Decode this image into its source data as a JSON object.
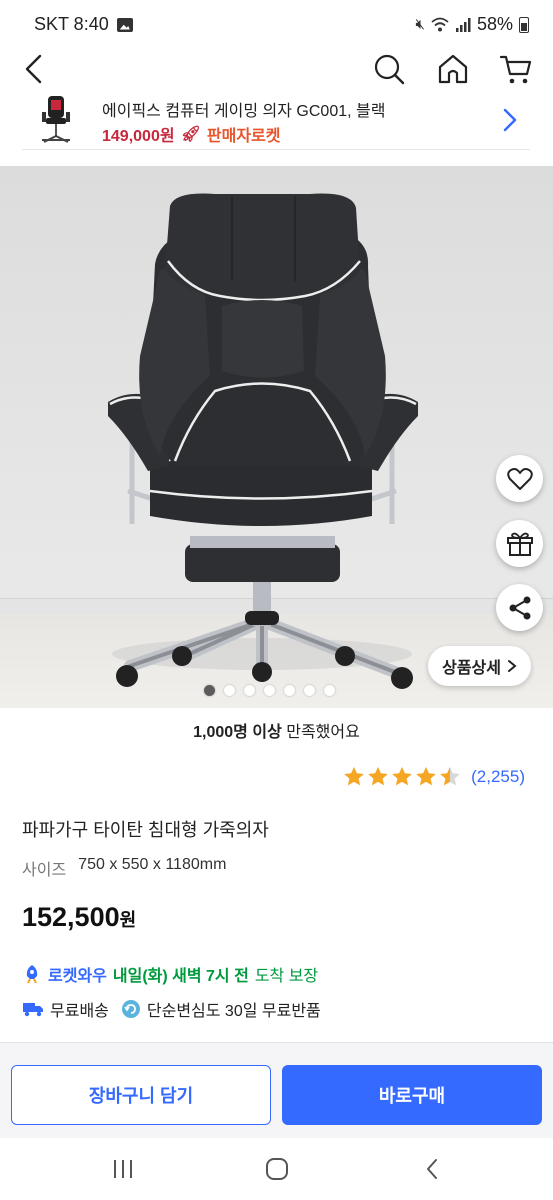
{
  "status_bar": {
    "carrier_time": "SKT 8:40",
    "battery": "58%"
  },
  "nav": {
    "back": "back-icon",
    "search": "search-icon",
    "home": "home-icon",
    "cart": "cart-icon"
  },
  "strip": {
    "name": "에이픽스 컴퓨터 게이밍 의자 GC001, 블랙",
    "price": "149,000원",
    "badge": "판매자로켓"
  },
  "hero": {
    "detail_button": "상품상세",
    "dots_count": 7,
    "active_dot": 0
  },
  "product": {
    "satisfied_bold": "1,000명 이상",
    "satisfied_rest": " 만족했어요",
    "rating_value": 4.5,
    "review_count": "(2,255)",
    "title": "파파가구 타이탄 침대형 가죽의자",
    "size_label": "사이즈",
    "size_value": "750 x 550 x 1180mm",
    "price_number": "152,500",
    "price_unit": "원",
    "delivery_program": "로켓와우",
    "delivery_arrival": "내일(화) 새벽 7시 전",
    "delivery_guarantee": "도착 보장",
    "free_shipping": "무료배송",
    "free_return": "단순변심도 30일 무료반품"
  },
  "buttons": {
    "cart": "장바구니 담기",
    "buy": "바로구매"
  },
  "colors": {
    "accent": "#346aff",
    "price_red": "#c8283c",
    "green": "#009a3e",
    "star": "#f5a623"
  }
}
